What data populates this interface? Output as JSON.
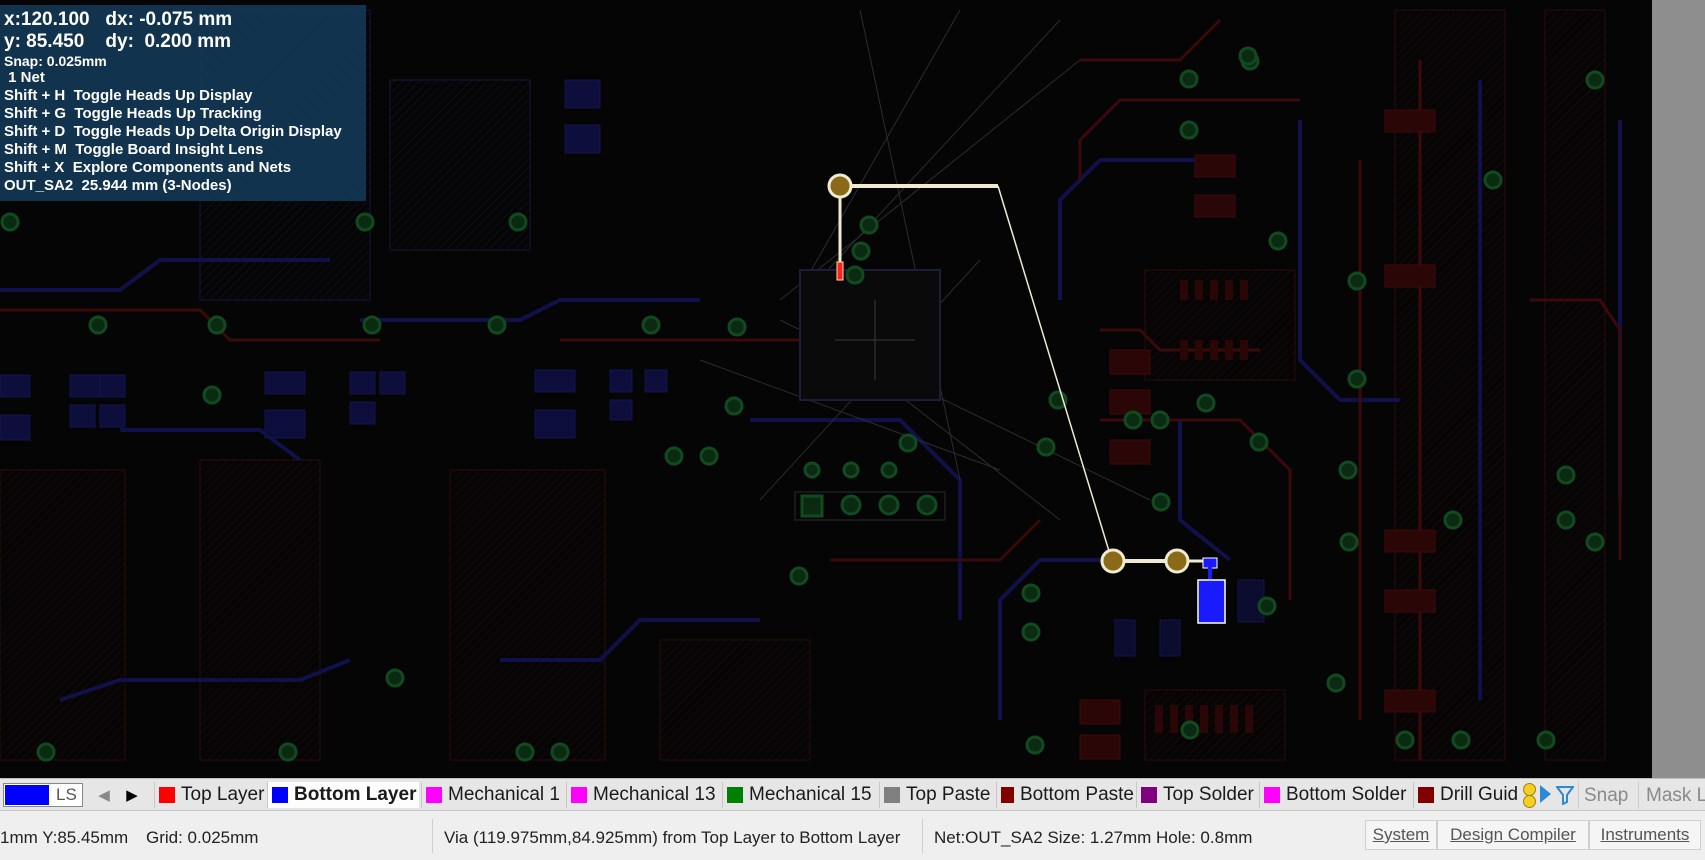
{
  "hud": {
    "line1": "x:120.100   dx: -0.075 mm",
    "line2": "y: 85.450    dy:  0.200 mm",
    "snap": "Snap: 0.025mm",
    "net_count": " 1 Net",
    "shortcuts": [
      "Shift + H  Toggle Heads Up Display",
      "Shift + G  Toggle Heads Up Tracking",
      "Shift + D  Toggle Heads Up Delta Origin Display",
      "Shift + M  Toggle Board Insight Lens",
      "Shift + X  Explore Components and Nets"
    ],
    "net_info": "OUT_SA2  25.944 mm (3-Nodes)"
  },
  "layerbar": {
    "ls_label": "LS",
    "current_color": "#0000ff",
    "layers": [
      {
        "label": "Top Layer",
        "color": "#ff0000"
      },
      {
        "label": "Bottom Layer",
        "color": "#0000ff",
        "active": true
      },
      {
        "label": "Mechanical 1",
        "color": "#ff00ff"
      },
      {
        "label": "Mechanical 13",
        "color": "#ff00ff"
      },
      {
        "label": "Mechanical 15",
        "color": "#008000"
      },
      {
        "label": "Top Paste",
        "color": "#808080"
      },
      {
        "label": "Bottom Paste",
        "color": "#800000"
      },
      {
        "label": "Top Solder",
        "color": "#800080"
      },
      {
        "label": "Bottom Solder",
        "color": "#ff00ff"
      },
      {
        "label": "Drill Guid",
        "color": "#800000"
      }
    ],
    "snap_label": "Snap",
    "mask_label": "Mask L"
  },
  "statusbar": {
    "coords": "1mm Y:85.45mm",
    "grid": "Grid: 0.025mm",
    "via_info": "Via (119.975mm,84.925mm) from Top Layer to Bottom Layer",
    "net_info": "Net:OUT_SA2 Size: 1.27mm Hole: 0.8mm",
    "buttons": [
      "System",
      "Design Compiler",
      "Instruments"
    ]
  }
}
